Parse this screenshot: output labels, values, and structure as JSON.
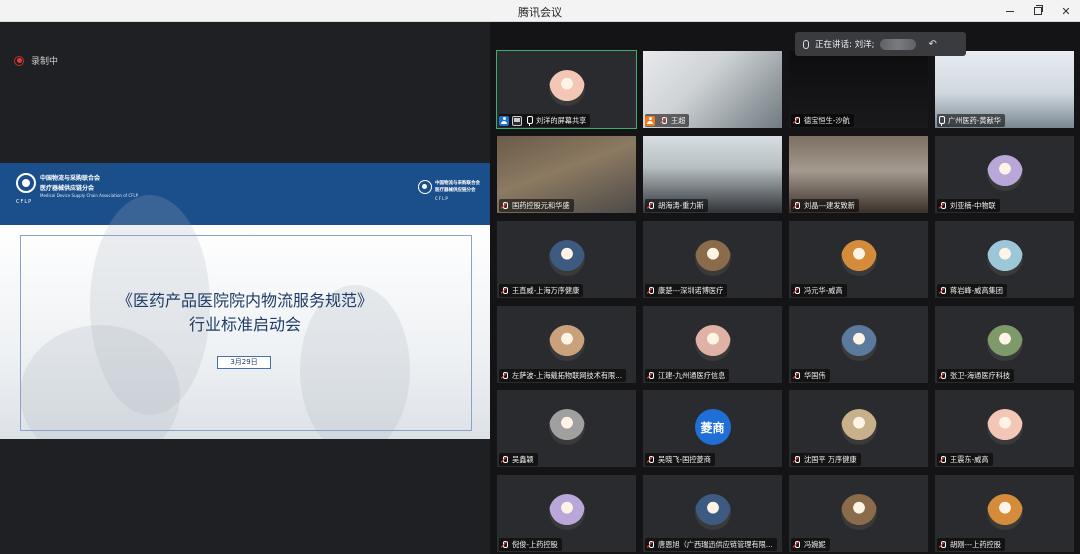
{
  "window": {
    "title": "腾讯会议",
    "min_icon": "minimize-icon",
    "max_icon": "restore-icon",
    "close_icon": "close-icon",
    "close_glyph": "✕"
  },
  "recording": {
    "label": "录制中",
    "icon": "record-dot-icon",
    "color": "#e03a3a"
  },
  "slide": {
    "org_line1": "中国物流与采购联合会",
    "org_line2": "医疗器械供应链分会",
    "org_tiny": "Medical Device Supply Chain Association of CFLP",
    "brand": "CFLP",
    "title_line1": "《医药产品医院院内物流服务规范》",
    "title_line2": "行业标准启动会",
    "date": "3月29日",
    "banner_color": "#1b4f8c"
  },
  "speaking": {
    "prefix": "正在讲话: 刘洋;",
    "undo_glyph": "↶"
  },
  "participants": [
    {
      "name": "刘洋的屏幕共享",
      "type": "avatar",
      "badges": [
        "person",
        "screen",
        "mic-on"
      ],
      "active": true
    },
    {
      "name": "王超",
      "type": "photo",
      "badges": [
        "host",
        "mic-off"
      ]
    },
    {
      "name": "德宝恒生-沙航",
      "type": "dark",
      "badges": [
        "mic-off"
      ]
    },
    {
      "name": "广州医药-黄献华",
      "type": "photo",
      "badges": [
        "mic-on"
      ]
    },
    {
      "name": "国药控股元和华盛",
      "type": "photo",
      "badges": [
        "mic-off"
      ]
    },
    {
      "name": "胡海涛-重力斯",
      "type": "photo",
      "badges": [
        "mic-off"
      ]
    },
    {
      "name": "刘晶---建发致新",
      "type": "photo",
      "badges": [
        "mic-off"
      ]
    },
    {
      "name": "刘亚楠-中物联",
      "type": "avatar",
      "badges": [
        "mic-off"
      ]
    },
    {
      "name": "王直威-上海万序健康",
      "type": "avatar",
      "badges": [
        "mic-off"
      ]
    },
    {
      "name": "康楚---深圳诺博医疗",
      "type": "avatar",
      "badges": [
        "mic-off"
      ]
    },
    {
      "name": "冯元华-威高",
      "type": "avatar",
      "badges": [
        "mic-off"
      ]
    },
    {
      "name": "蒋岩峰-威高集团",
      "type": "avatar",
      "badges": [
        "mic-off"
      ]
    },
    {
      "name": "左萨波-上海戴拓物联网技术有限...",
      "type": "avatar",
      "badges": [
        "mic-off"
      ]
    },
    {
      "name": "江建-九州通医疗信息",
      "type": "avatar",
      "badges": [
        "mic-off"
      ]
    },
    {
      "name": "华国伟",
      "type": "avatar",
      "badges": [
        "mic-off"
      ]
    },
    {
      "name": "张卫-海通医疗科技",
      "type": "avatar",
      "badges": [
        "mic-off"
      ]
    },
    {
      "name": "吴鑫颖",
      "type": "avatar",
      "badges": [
        "mic-off"
      ]
    },
    {
      "name": "吴晓飞-国控菱商",
      "type": "text-avatar",
      "avatar_text": "菱商",
      "badges": [
        "mic-off"
      ]
    },
    {
      "name": "沈国平 万序健康",
      "type": "avatar",
      "badges": [
        "mic-off"
      ]
    },
    {
      "name": "王震东-威高",
      "type": "avatar",
      "badges": [
        "mic-off"
      ]
    },
    {
      "name": "倪俊-上药控股",
      "type": "avatar",
      "badges": [
        "mic-off"
      ]
    },
    {
      "name": "唐恩旭（广西瑞迅供应链管理有限...",
      "type": "avatar",
      "badges": [
        "mic-off"
      ]
    },
    {
      "name": "冯婉妮",
      "type": "avatar",
      "badges": [
        "mic-off"
      ]
    },
    {
      "name": "胡刚---上药控股",
      "type": "avatar",
      "badges": [
        "mic-off"
      ]
    }
  ]
}
